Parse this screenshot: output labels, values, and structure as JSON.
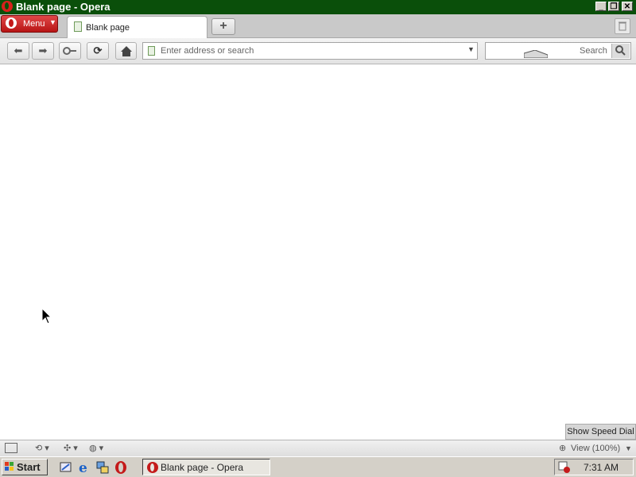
{
  "window": {
    "title": "Blank page - Opera",
    "controls": {
      "minimize": "_",
      "restore": "❐",
      "close": "✕"
    }
  },
  "tabbar": {
    "menu_label": "Menu",
    "active_tab_label": "Blank page",
    "new_tab_symbol": "+"
  },
  "toolbar": {
    "address_placeholder": "Enter address or search",
    "search_placeholder": "Search"
  },
  "content": {
    "speed_dial_label": "Show Speed Dial"
  },
  "statusbar": {
    "zoom_label": "View (100%)"
  },
  "taskbar": {
    "start_label": "Start",
    "task_label": "Blank page - Opera",
    "clock": "7:31 AM"
  },
  "colors": {
    "titlebar": "#0a4f0a",
    "opera_red": "#c41a1a",
    "taskbar": "#d4d0c8"
  }
}
